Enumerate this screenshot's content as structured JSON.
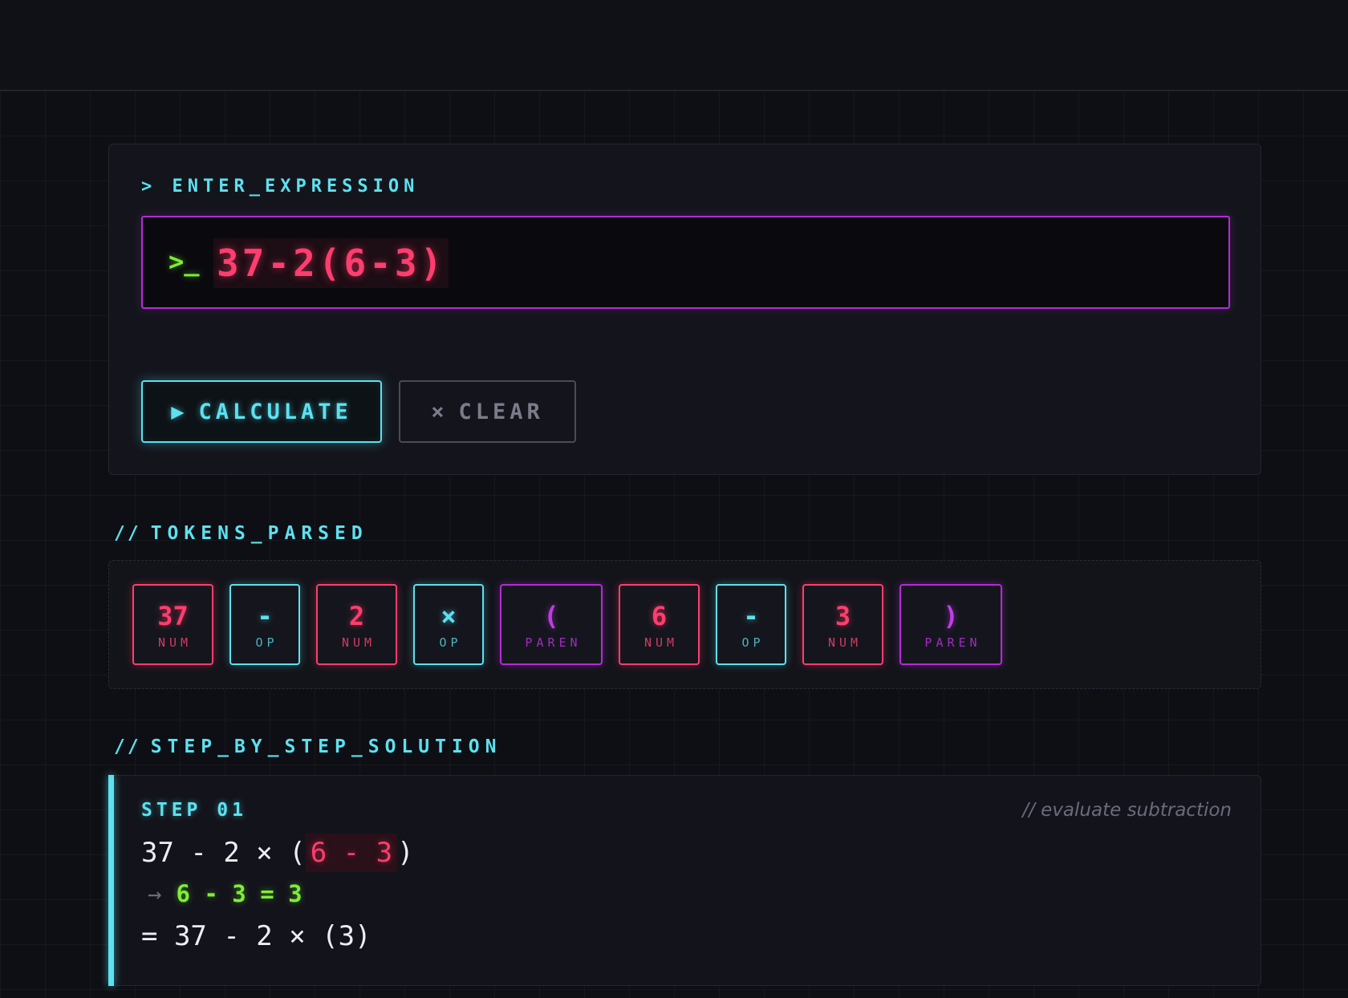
{
  "input": {
    "label": "> ENTER_EXPRESSION",
    "prompt": ">_",
    "expression": "37-2(6-3)"
  },
  "buttons": {
    "calculate_icon": "▶",
    "calculate_label": "CALCULATE",
    "clear_icon": "×",
    "clear_label": "CLEAR"
  },
  "tokens": {
    "title_prefix": "//",
    "title": "TOKENS_PARSED",
    "items": [
      {
        "value": "37",
        "type": "NUM"
      },
      {
        "value": "-",
        "type": "OP"
      },
      {
        "value": "2",
        "type": "NUM"
      },
      {
        "value": "×",
        "type": "OP"
      },
      {
        "value": "(",
        "type": "PAREN"
      },
      {
        "value": "6",
        "type": "NUM"
      },
      {
        "value": "-",
        "type": "OP"
      },
      {
        "value": "3",
        "type": "NUM"
      },
      {
        "value": ")",
        "type": "PAREN"
      }
    ]
  },
  "solution": {
    "title_prefix": "//",
    "title": "STEP_BY_STEP_SOLUTION",
    "steps": [
      {
        "label": "STEP 01",
        "note": "// evaluate subtraction",
        "expr_before": "37 - 2 × (",
        "expr_highlight": "6 - 3",
        "expr_after": ")",
        "arrow": "→",
        "computation": "6 - 3 = 3",
        "result": "= 37 - 2 × (3)"
      }
    ]
  },
  "colors": {
    "cyan": "#5ce1f0",
    "magenta": "#b42bd6",
    "pink": "#ff3d6e",
    "green": "#7dee35",
    "background": "#0e0f14"
  }
}
